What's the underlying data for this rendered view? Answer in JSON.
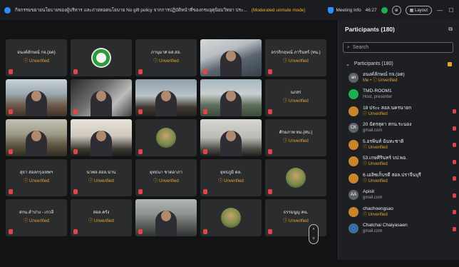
{
  "titlebar": {
    "meeting_title": "กิจกรรมขยายนโยบายของผู้บริหาร และถ่ายทอดนโยบาย No gift policy จากการปฏิบัติหน้าที่ของกรมอุตุนิยมวิทยา ประ...",
    "moderation": "(Moderated unmute mode)",
    "meeting_info": "Meeting Info",
    "timer": "46:27",
    "layout": "Layout"
  },
  "gallery": {
    "tiles": [
      {
        "name": "อนงค์ลักษณ์ กจ.(อต)",
        "status": "Unverified",
        "kind": "text"
      },
      {
        "name": "",
        "status": "",
        "kind": "logo"
      },
      {
        "name": "ภานุมาศ ผส.สอ.",
        "status": "Unverified",
        "kind": "text"
      },
      {
        "name": "",
        "status": "",
        "kind": "video"
      },
      {
        "name": "อรรถิกฤษณ์ ภารินทร์ (ทน.)",
        "status": "Unverified",
        "kind": "text"
      },
      {
        "name": "",
        "status": "",
        "kind": "video"
      },
      {
        "name": "",
        "status": "",
        "kind": "video"
      },
      {
        "name": "",
        "status": "",
        "kind": "video"
      },
      {
        "name": "",
        "status": "",
        "kind": "video"
      },
      {
        "name": "นภสร",
        "status": "Unverified",
        "kind": "text"
      },
      {
        "name": "",
        "status": "",
        "kind": "video"
      },
      {
        "name": "",
        "status": "",
        "kind": "video"
      },
      {
        "name": "",
        "status": "",
        "kind": "avatar"
      },
      {
        "name": "",
        "status": "",
        "kind": "video"
      },
      {
        "name": "ศักยภาพ ทม.(ศบ.)",
        "status": "Unverified",
        "kind": "text"
      },
      {
        "name": "สุธา สอลกรุงเทพฯ",
        "status": "Unverified",
        "kind": "text"
      },
      {
        "name": "นวพล สอล.น่าน",
        "status": "Unverified",
        "kind": "text"
      },
      {
        "name": "ยุทธนา ชาตอาภา",
        "status": "Unverified",
        "kind": "text"
      },
      {
        "name": "ยุทธภูมิ ดล.",
        "status": "Unverified",
        "kind": "text"
      },
      {
        "name": "",
        "status": "",
        "kind": "avatar"
      },
      {
        "name": "สกน.ลำปาง - เกวลี",
        "status": "Unverified",
        "kind": "text"
      },
      {
        "name": "สอล.ครัง",
        "status": "Unverified",
        "kind": "text"
      },
      {
        "name": "",
        "status": "",
        "kind": "video"
      },
      {
        "name": "",
        "status": "",
        "kind": "avatar"
      },
      {
        "name": "ธรรมนูญ คน.",
        "status": "Unverified",
        "kind": "text"
      }
    ]
  },
  "panel": {
    "title": "Participants (180)",
    "search_placeholder": "Search",
    "group_label": "Participants (180)",
    "participants": [
      {
        "initials": "an",
        "name": "อนงค์ลักษณ์ กจ.(อต)",
        "sub": "Me • ⓘ Unverified",
        "color": "#5f6368",
        "muted": false
      },
      {
        "initials": "",
        "name": "TMD-ROOM1",
        "sub": "Host, presenter",
        "color": "#1fae51",
        "muted": false
      },
      {
        "initials": "",
        "name": "18 ประะ สอล.นครนายก",
        "sub": "ⓘ Unverified",
        "color": "#c9852c",
        "muted": true
      },
      {
        "initials": "CK",
        "name": "20 ฉัตรสุดา สกน.ระนอง",
        "sub": "gmail.com",
        "color": "#5f6368",
        "muted": true
      },
      {
        "initials": "",
        "name": "5.อรพินท์ ฉันทะชาติ",
        "sub": "ⓘ Unverified",
        "color": "#c9852c",
        "muted": true
      },
      {
        "initials": "",
        "name": "53.เกษศิรินทร์ บป.พอ.",
        "sub": "ⓘ Unverified",
        "color": "#c9852c",
        "muted": true
      },
      {
        "initials": "",
        "name": "6.เอลิซเก็บรดี สอล.ปราจีนบุรี",
        "sub": "ⓘ Unverified",
        "color": "#c9852c",
        "muted": true
      },
      {
        "initials": "AA",
        "name": "Apisit",
        "sub": "gmail.com",
        "color": "#5f6368",
        "muted": true
      },
      {
        "initials": "",
        "name": "chachoengsao",
        "sub": "ⓘ Unverified",
        "color": "#c9852c",
        "muted": true
      },
      {
        "initials": "",
        "name": "Chatchai Chaiyasaen",
        "sub": "gmail.com",
        "color": "#3c6e9f",
        "muted": true
      }
    ]
  },
  "colors": {
    "unverified": "#e3a72f",
    "mute": "#e0454a",
    "accent": "#2d8cff"
  }
}
